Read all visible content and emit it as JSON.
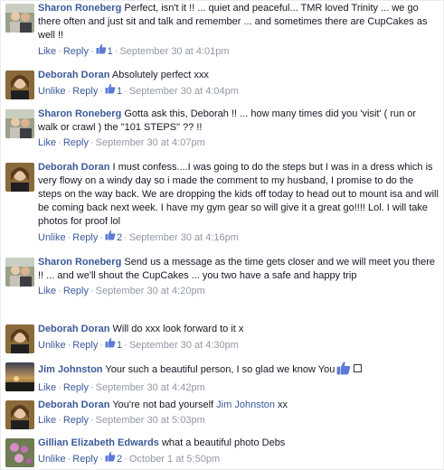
{
  "comments": [
    {
      "author": "Sharon Roneberg",
      "text": "Perfect, isn't it !! ... quiet and peaceful... TMR loved Trinity ... we go there often and just sit and talk and remember ... and sometimes there are CupCakes as well !!",
      "like_label": "Like",
      "reply_label": "Reply",
      "likes": "1",
      "time": "September 30 at 4:01pm"
    },
    {
      "author": "Deborah Doran",
      "text": "Absolutely perfect xxx",
      "like_label": "Unlike",
      "reply_label": "Reply",
      "likes": "1",
      "time": "September 30 at 4:04pm"
    },
    {
      "author": "Sharon Roneberg",
      "text": "Gotta ask this, Deborah !! ... how many times did you 'visit' ( run or walk or crawl ) the \"101 STEPS\" ?? !!",
      "like_label": "Like",
      "reply_label": "Reply",
      "time": "September 30 at 4:07pm"
    },
    {
      "author": "Deborah Doran",
      "text": "I must confess....I was going to do the steps but I was in a dress which is very flowy on a windy day so i made the comment to my husband, I promise to do the steps on the way back. We are dropping the kids off today to head out to mount isa and will be coming back next week. I have my gym gear so will give it a great go!!!! Lol. I will take photos for proof lol",
      "like_label": "Unlike",
      "reply_label": "Reply",
      "likes": "2",
      "time": "September 30 at 4:16pm"
    },
    {
      "author": "Sharon Roneberg",
      "text": "Send us a message as the time gets closer and we will meet you there !! ... and we'll shout the CupCakes ... you two have a safe and happy trip",
      "like_label": "Like",
      "reply_label": "Reply",
      "time": "September 30 at 4:20pm"
    },
    {
      "author": "Deborah Doran",
      "text": "Will do xxx look forward to it x",
      "like_label": "Unlike",
      "reply_label": "Reply",
      "likes": "1",
      "time": "September 30 at 4:30pm"
    },
    {
      "author": "Jim Johnston",
      "text": "Your such a beautiful person, I so glad we know You",
      "like_label": "Like",
      "reply_label": "Reply",
      "time": "September 30 at 4:42pm"
    },
    {
      "author": "Deborah Doran",
      "text": "You're not bad yourself",
      "mention": "Jim Johnston",
      "text_after": " xx",
      "like_label": "Like",
      "reply_label": "Reply",
      "time": "September 30 at 5:03pm"
    },
    {
      "author": "Gillian Elizabeth Edwards",
      "text": "what a beautiful photo Debs",
      "like_label": "Unlike",
      "reply_label": "Reply",
      "likes": "2",
      "time": "October 1 at 5:50pm"
    }
  ],
  "colors": {
    "link": "#3b5998",
    "meta": "#9197a3",
    "text": "#141823"
  }
}
